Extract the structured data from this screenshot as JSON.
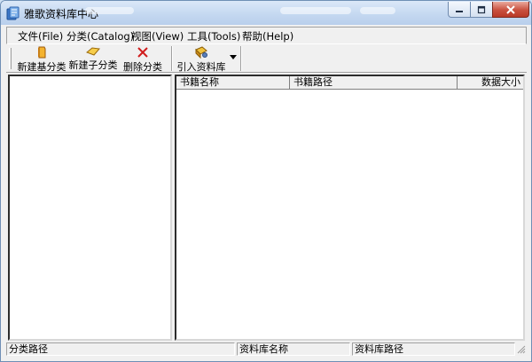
{
  "window": {
    "title": "雅歌资料库中心"
  },
  "menu": [
    {
      "label": "文件(File)"
    },
    {
      "label": "分类(Catalog)"
    },
    {
      "label": "视图(View)"
    },
    {
      "label": "工具(Tools)"
    },
    {
      "label": "帮助(Help)"
    }
  ],
  "toolbar": {
    "new_root_category": {
      "label": "新建基分类",
      "icon": "book-icon"
    },
    "new_sub_category": {
      "label": "新建子分类",
      "icon": "tag-icon"
    },
    "delete_category": {
      "label": "删除分类",
      "icon": "red-x-icon"
    },
    "import_library": {
      "label": "引入资料库",
      "icon": "import-icon"
    }
  },
  "list": {
    "columns": [
      {
        "label": "书籍名称"
      },
      {
        "label": "书籍路径"
      },
      {
        "label": "数据大小"
      }
    ]
  },
  "status": {
    "category_path": "分类路径",
    "library_name": "资料库名称",
    "library_path": "资料库路径"
  },
  "colors": {
    "titlebar": "#c3d7f0",
    "close_button": "#c9503e",
    "window_bg": "#f0f0f0"
  }
}
